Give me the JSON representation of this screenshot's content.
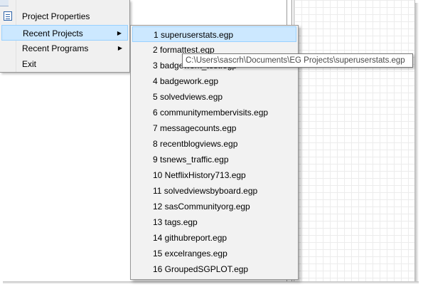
{
  "file_menu": {
    "items": [
      {
        "label": "Project Properties",
        "has_submenu": false,
        "icon": "properties-icon"
      },
      {
        "label": "Recent Projects",
        "has_submenu": true,
        "selected": true
      },
      {
        "label": "Recent Programs",
        "has_submenu": true
      },
      {
        "label": "Exit",
        "has_submenu": false
      }
    ],
    "submenu_arrow": "▶"
  },
  "recent_projects": {
    "items": [
      "1 superuserstats.egp",
      "2 formattest.egp",
      "3 badgework_test.egp",
      "4 badgework.egp",
      "5 solvedviews.egp",
      "6 communitymembervisits.egp",
      "7 messagecounts.egp",
      "8 recentblogviews.egp",
      "9 tsnews_traffic.egp",
      "10 NetflixHistory713.egp",
      "11 solvedviewsbyboard.egp",
      "12 sasCommunityorg.egp",
      "13 tags.egp",
      "14 githubreport.egp",
      "15 excelranges.egp",
      "16 GroupedSGPLOT.egp"
    ],
    "selected_index": 0
  },
  "tooltip": {
    "text": "C:\\Users\\sascrh\\Documents\\EG Projects\\superuserstats.egp"
  },
  "colors": {
    "highlight_bg": "#cce8ff",
    "highlight_border": "#99d1ff",
    "menu_bg": "#f0f0f0"
  }
}
